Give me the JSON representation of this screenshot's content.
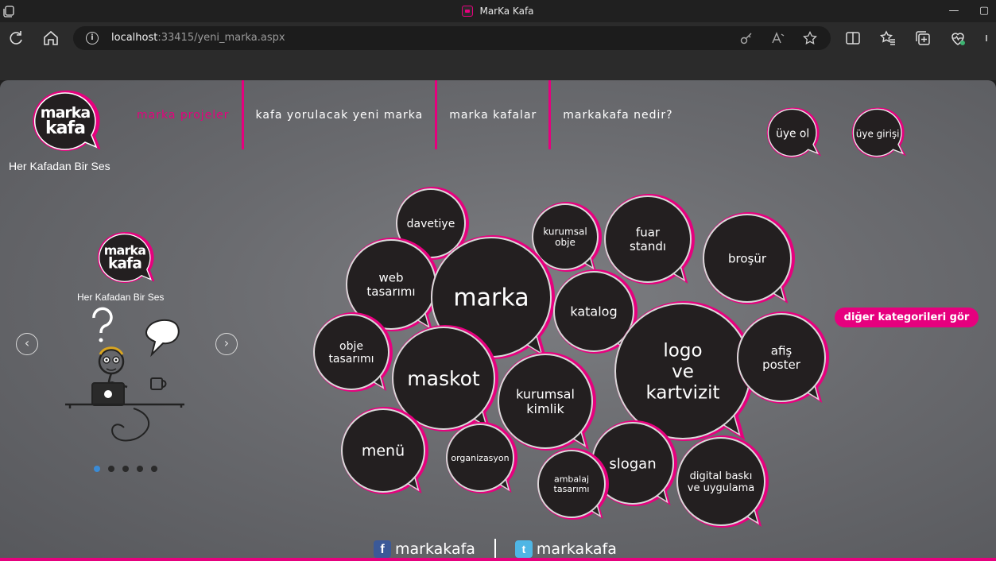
{
  "browser": {
    "title": "MarKa Kafa",
    "url_host": "localhost",
    "url_rest": ":33415/yeni_marka.aspx"
  },
  "site": {
    "tagline": "Her Kafadan Bir Ses",
    "colors": {
      "accent": "#e6007e",
      "bubble": "#231f20",
      "background": "#6e6f73"
    },
    "nav": [
      {
        "label": "marka projeler",
        "active": true
      },
      {
        "label": "kafa yorulacak yeni marka",
        "active": false
      },
      {
        "label": "marka kafalar",
        "active": false
      },
      {
        "label": "markakafa nedir?",
        "active": false
      }
    ],
    "account": {
      "signup": "üye ol",
      "login": "üye girişi"
    },
    "slider": {
      "tagline": "Her Kafadan Bir Ses",
      "prev_icon": "chevron-left-icon",
      "next_icon": "chevron-right-icon",
      "dots": 5,
      "active_dot": 1
    },
    "categories": [
      {
        "id": "davetiye",
        "lines": [
          "davetiye"
        ]
      },
      {
        "id": "kurumsal-obje",
        "lines": [
          "kurumsal",
          "obje"
        ]
      },
      {
        "id": "fuar-standi",
        "lines": [
          "fuar",
          "standı"
        ]
      },
      {
        "id": "brosur",
        "lines": [
          "broşür"
        ]
      },
      {
        "id": "web-tasarimi",
        "lines": [
          "web",
          "tasarımı"
        ]
      },
      {
        "id": "marka",
        "lines": [
          "marka"
        ]
      },
      {
        "id": "katalog",
        "lines": [
          "katalog"
        ]
      },
      {
        "id": "obje-tasarimi",
        "lines": [
          "obje",
          "tasarımı"
        ]
      },
      {
        "id": "maskot",
        "lines": [
          "maskot"
        ]
      },
      {
        "id": "logo-ve-kartvizit",
        "lines": [
          "logo",
          "ve",
          "kartvizit"
        ]
      },
      {
        "id": "afis-poster",
        "lines": [
          "afiş",
          "poster"
        ]
      },
      {
        "id": "kurumsal-kimlik",
        "lines": [
          "kurumsal",
          "kimlik"
        ]
      },
      {
        "id": "menu",
        "lines": [
          "menü"
        ]
      },
      {
        "id": "organizasyon",
        "lines": [
          "organizasyon"
        ]
      },
      {
        "id": "slogan",
        "lines": [
          "slogan"
        ]
      },
      {
        "id": "ambalaj-tasarimi",
        "lines": [
          "ambalaj",
          "tasarımı"
        ]
      },
      {
        "id": "digital-baski",
        "lines": [
          "digital baskı",
          "ve uygulama"
        ]
      }
    ],
    "more_categories": "diğer kategorileri gör",
    "social": [
      {
        "network": "facebook",
        "icon": "facebook-icon",
        "label": "markakafa"
      },
      {
        "network": "twitter",
        "icon": "twitter-icon",
        "label": "markakafa"
      }
    ]
  }
}
